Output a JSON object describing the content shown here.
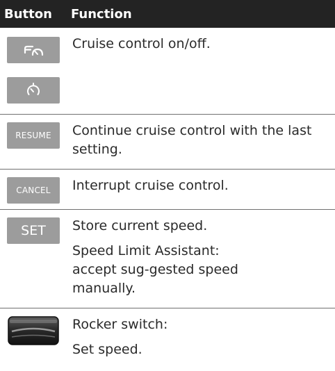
{
  "header": {
    "col_button": "Button",
    "col_function": "Function"
  },
  "rows": [
    {
      "buttons": [
        {
          "icon": "cruise-control-icon"
        },
        {
          "icon": "speedometer-icon"
        }
      ],
      "lines": [
        "Cruise control on/off."
      ]
    },
    {
      "buttons": [
        {
          "label": "RESUME"
        }
      ],
      "lines": [
        "Continue cruise control with the last setting."
      ]
    },
    {
      "buttons": [
        {
          "label": "CANCEL"
        }
      ],
      "lines": [
        "Interrupt cruise control."
      ]
    },
    {
      "buttons": [
        {
          "label": "SET"
        }
      ],
      "lines": [
        "Store current speed.",
        "Speed Limit Assistant: accept sug-gested speed manually."
      ]
    },
    {
      "buttons": [
        {
          "icon": "rocker-switch-icon"
        }
      ],
      "lines": [
        "Rocker switch:",
        "Set speed."
      ]
    }
  ]
}
